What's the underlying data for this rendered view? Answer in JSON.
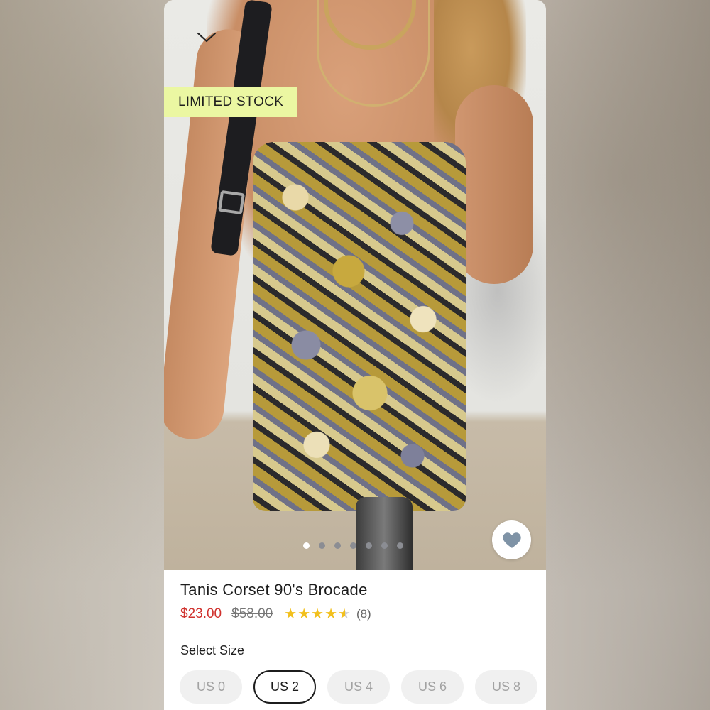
{
  "product": {
    "badge": "LIMITED STOCK",
    "title": "Tanis Corset 90's Brocade",
    "price": "$23.00",
    "original_price": "$58.00",
    "rating": 4.5,
    "review_count": "(8)",
    "image_carousel": {
      "count": 7,
      "active_index": 0
    }
  },
  "size_section": {
    "label": "Select Size",
    "options": [
      {
        "label": "US 0",
        "available": false
      },
      {
        "label": "US 2",
        "available": true,
        "selected": true
      },
      {
        "label": "US 4",
        "available": false
      },
      {
        "label": "US 6",
        "available": false
      },
      {
        "label": "US 8",
        "available": false
      }
    ]
  },
  "icons": {
    "collapse": "chevron-down-icon",
    "wishlist": "heart-icon",
    "rating": "star-icon"
  },
  "colors": {
    "price": "#d0312d",
    "badge_bg": "#ebf7a2",
    "star": "#f2c01d",
    "heart": "#7f93a6"
  }
}
